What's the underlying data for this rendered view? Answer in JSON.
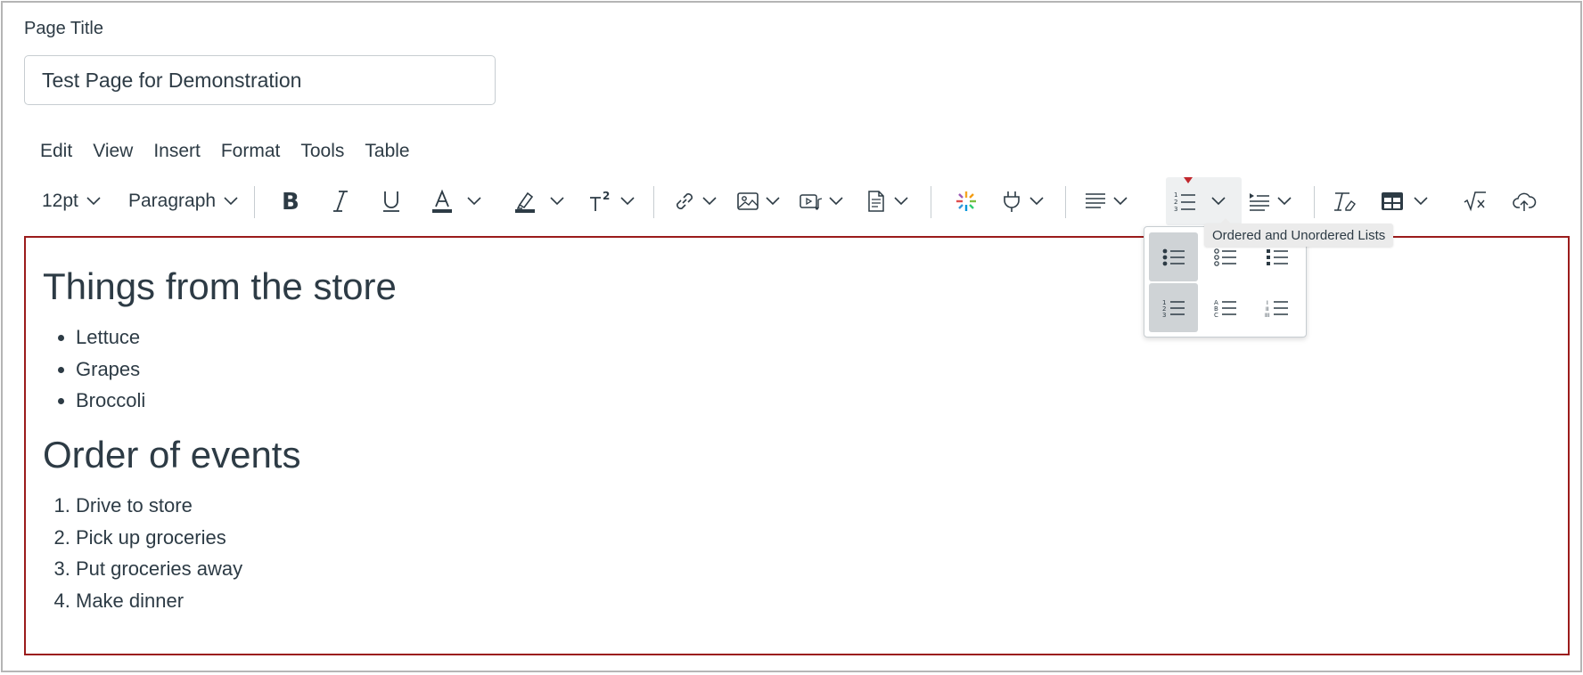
{
  "page_title": {
    "label": "Page Title",
    "value": "Test Page for Demonstration"
  },
  "menubar": {
    "items": [
      "Edit",
      "View",
      "Insert",
      "Format",
      "Tools",
      "Table"
    ]
  },
  "toolbar": {
    "font_size": "12pt",
    "block_format": "Paragraph",
    "bold_icon": "bold-icon",
    "italic_icon": "italic-icon",
    "underline_icon": "underline-icon",
    "text_color_icon": "text-color-icon",
    "highlight_icon": "highlight-icon",
    "superscript_icon": "superscript-icon",
    "link_icon": "link-icon",
    "image_icon": "image-icon",
    "media_icon": "media-icon",
    "document_icon": "document-icon",
    "apps_icon": "apps-icon",
    "plugin_icon": "plugin-icon",
    "align_icon": "align-icon",
    "list_icon": "ordered-list-icon",
    "indent_icon": "indent-icon",
    "clear_format_icon": "clear-formatting-icon",
    "table_icon": "table-icon",
    "math_icon": "math-equation-icon",
    "upload_icon": "cloud-upload-icon",
    "accent_color": "#c1272d",
    "tooltip": "Ordered and Unordered Lists"
  },
  "list_styles": {
    "items": [
      {
        "name": "bulleted-list-disc",
        "selected": true
      },
      {
        "name": "bulleted-list-circle",
        "selected": false
      },
      {
        "name": "bulleted-list-square",
        "selected": false
      },
      {
        "name": "numbered-list-decimal",
        "selected": true
      },
      {
        "name": "numbered-list-alpha",
        "selected": false
      },
      {
        "name": "numbered-list-roman",
        "selected": false
      }
    ]
  },
  "editor": {
    "heading1": "Things from the store",
    "bullets": [
      "Lettuce",
      "Grapes",
      "Broccoli"
    ],
    "heading2": "Order of events",
    "numbered": [
      "Drive to store",
      "Pick up groceries",
      "Put groceries away",
      "Make dinner"
    ],
    "border_color": "#9b1c1c"
  }
}
